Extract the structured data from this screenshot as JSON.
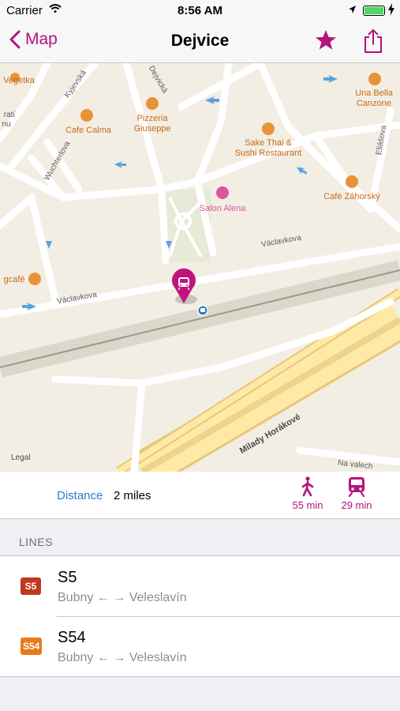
{
  "status_bar": {
    "carrier": "Carrier",
    "time": "8:56 AM"
  },
  "nav": {
    "back_label": "Map",
    "title": "Dejvice"
  },
  "map": {
    "legal": "Legal",
    "labels": {
      "vegetka": "Vegetka",
      "kyjevska": "Kyjevská",
      "dejvicka": "Dejvická",
      "una_bella_1": "Una Bella",
      "una_bella_2": "Canzone",
      "strati_1": "ratí",
      "strati_2": "nu",
      "cafe_calma": "Cafe Calma",
      "pizzeria_1": "Pizzeria",
      "pizzeria_2": "Giuseppe",
      "sake_1": "Sake Thai &",
      "sake_2": "Sushi Restaurant",
      "eliasova": "Eliášova",
      "wuchterlova": "Wuchterlova",
      "cafe_zahorsky": "Café Záhorský",
      "salon_alena": "Salon Alena",
      "vaclavkova_1": "Václavkova",
      "gcafe": "gcafé",
      "vaclavkova_2": "Václavkova",
      "milady": "Milady Horákové",
      "na_valech": "Na valech"
    }
  },
  "info": {
    "distance_label": "Distance",
    "distance_value": "2 miles",
    "walk_time": "55 min",
    "train_time": "29 min"
  },
  "lines_header": "LINES",
  "lines": [
    {
      "badge": "S5",
      "name": "S5",
      "route": "Bubny ← → Veleslavín"
    },
    {
      "badge": "S54",
      "name": "S54",
      "route": "Bubny ← → Veleslavín"
    }
  ],
  "colors": {
    "accent": "#b5127d",
    "link": "#2f7dc4",
    "badge_s5": "#c0391b",
    "badge_s54": "#e87a1e",
    "poi": "#e8923a",
    "poi_text": "#c96a17",
    "salon": "#d9579d"
  }
}
